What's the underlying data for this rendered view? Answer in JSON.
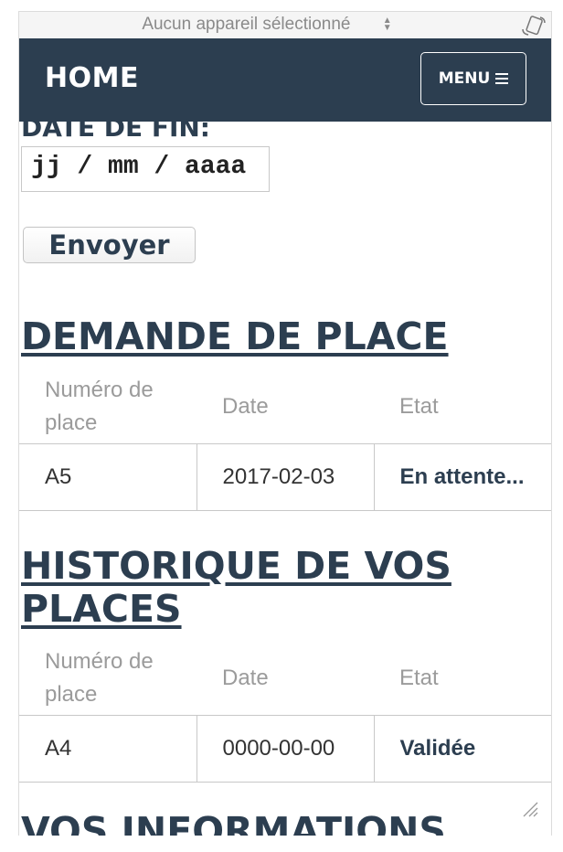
{
  "device_bar": {
    "selector_label": "Aucun appareil sélectionné"
  },
  "navbar": {
    "brand": "HOME",
    "menu_label": "MENU"
  },
  "form": {
    "end_date_label": "DATE DE FIN:",
    "end_date_placeholder": "jj / mm / aaaa",
    "submit_label": "Envoyer"
  },
  "requests": {
    "title": "DEMANDE DE PLACE",
    "columns": [
      "Numéro de place",
      "Date",
      "Etat"
    ],
    "rows": [
      {
        "place": "A5",
        "date": "2017-02-03",
        "state": "En attente..."
      }
    ]
  },
  "history": {
    "title": "HISTORIQUE DE VOS PLACES",
    "columns": [
      "Numéro de place",
      "Date",
      "Etat"
    ],
    "rows": [
      {
        "place": "A4",
        "date": "0000-00-00",
        "state": "Validée"
      }
    ]
  },
  "info": {
    "title": "VOS INFORMATIONS"
  },
  "colors": {
    "navbar_bg": "#2c3e50",
    "heading": "#2c3e50",
    "header_text": "#9b9b9b"
  }
}
